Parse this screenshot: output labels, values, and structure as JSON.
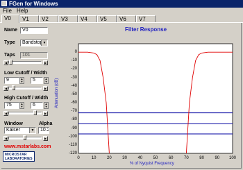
{
  "window": {
    "title": "FGen for Windows"
  },
  "menu": {
    "file": "File",
    "help": "Help"
  },
  "tabs": [
    "V0",
    "V1",
    "V2",
    "V3",
    "V4",
    "V5",
    "V6",
    "V7"
  ],
  "form": {
    "name_label": "Name",
    "name_value": "V0",
    "type_label": "Type",
    "type_value": "Bandstop",
    "taps_label": "Taps",
    "taps_value": "101",
    "low_label": "Low Cutoff / Width",
    "low_cutoff": "9",
    "low_width": "5",
    "high_label": "High Cutoff / Width",
    "high_cutoff": "75",
    "high_width": "6",
    "window_label": "Window",
    "alpha_label": "Alpha",
    "window_value": "Kaiser",
    "alpha_value": "10.2"
  },
  "footer": {
    "url": "www.mstarlabs.com",
    "logo_line1": "MICROSTAR",
    "logo_line2": "LABORATORIES"
  },
  "colors": {
    "title_bar": "#0a246a",
    "chart_text": "#2020c0",
    "response_curve": "#e00000",
    "ref_lines": "#0000a0"
  },
  "chart_data": {
    "type": "line",
    "title": "Filter Response",
    "xlabel": "% of Nyquist Frequency",
    "ylabel": "Attenuation (dB)",
    "xlim": [
      0,
      100
    ],
    "ylim": [
      -120,
      10
    ],
    "x_ticks": [
      0,
      10,
      20,
      30,
      40,
      50,
      60,
      70,
      80,
      90,
      100
    ],
    "y_ticks": [
      0,
      -10,
      -20,
      -30,
      -40,
      -50,
      -60,
      -70,
      -80,
      -90,
      -100,
      -110,
      -120
    ],
    "series": [
      {
        "x": [
          0,
          6,
          10,
          12,
          14,
          16,
          18,
          19,
          20
        ],
        "values": [
          0,
          0,
          -1,
          -3,
          -10,
          -30,
          -60,
          -90,
          -120
        ]
      },
      {
        "x": [
          70,
          71,
          72,
          74,
          76,
          78,
          80,
          84,
          100
        ],
        "values": [
          -120,
          -90,
          -60,
          -30,
          -10,
          -3,
          -1,
          0,
          0
        ]
      }
    ],
    "reference_lines": [
      -72,
      -85,
      -97
    ],
    "grid": false,
    "legend": "none"
  }
}
